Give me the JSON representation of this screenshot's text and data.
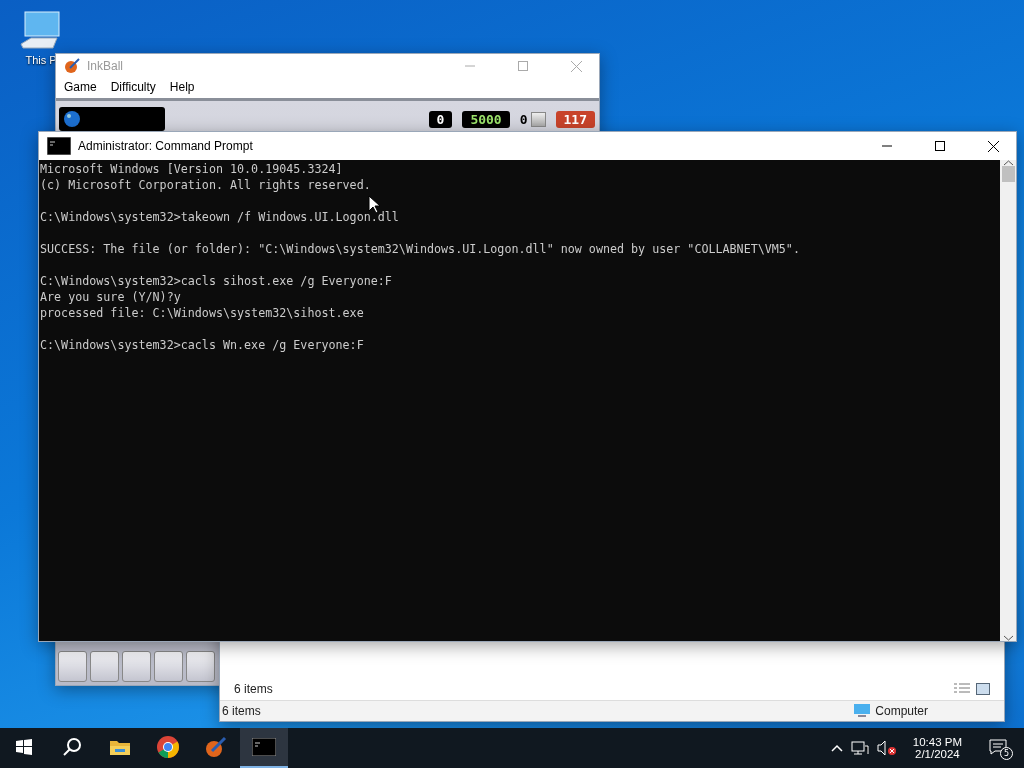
{
  "desktop_icons": [
    {
      "label": "This P"
    }
  ],
  "inkball": {
    "title": "InkBall",
    "menu": [
      "Game",
      "Difficulty",
      "Help"
    ],
    "counters": [
      {
        "kind": "score",
        "text": "0"
      },
      {
        "kind": "goal",
        "text": "5000"
      },
      {
        "kind": "balls",
        "text": "0"
      },
      {
        "kind": "timer",
        "text": "117"
      }
    ]
  },
  "explorer": {
    "item_count": "6 items",
    "status_bar": {
      "left": "6 items",
      "right": "Computer"
    }
  },
  "command_prompt": {
    "title": "Administrator: Command Prompt",
    "blocks": [
      [
        "Microsoft Windows [Version 10.0.19045.3324]",
        "(c) Microsoft Corporation. All rights reserved."
      ],
      [
        "C:\\Windows\\system32>takeown /f Windows.UI.Logon.dll"
      ],
      [
        "SUCCESS: The file (or folder): \"C:\\Windows\\system32\\Windows.UI.Logon.dll\" now owned by user \"COLLABNET\\VM5\"."
      ],
      [
        "C:\\Windows\\system32>cacls sihost.exe /g Everyone:F",
        "Are you sure (Y/N)?y",
        "processed file: C:\\Windows\\system32\\sihost.exe"
      ],
      [
        "C:\\Windows\\system32>cacls Wn.exe /g Everyone:F"
      ]
    ]
  },
  "taskbar": {
    "apps": [
      {
        "kind": "explorer",
        "selected": false
      },
      {
        "kind": "chrome",
        "selected": false
      },
      {
        "kind": "inkball",
        "selected": false
      },
      {
        "kind": "cmd",
        "selected": true
      }
    ],
    "time": "10:43 PM",
    "date": "2/1/2024",
    "notifications": "5"
  }
}
